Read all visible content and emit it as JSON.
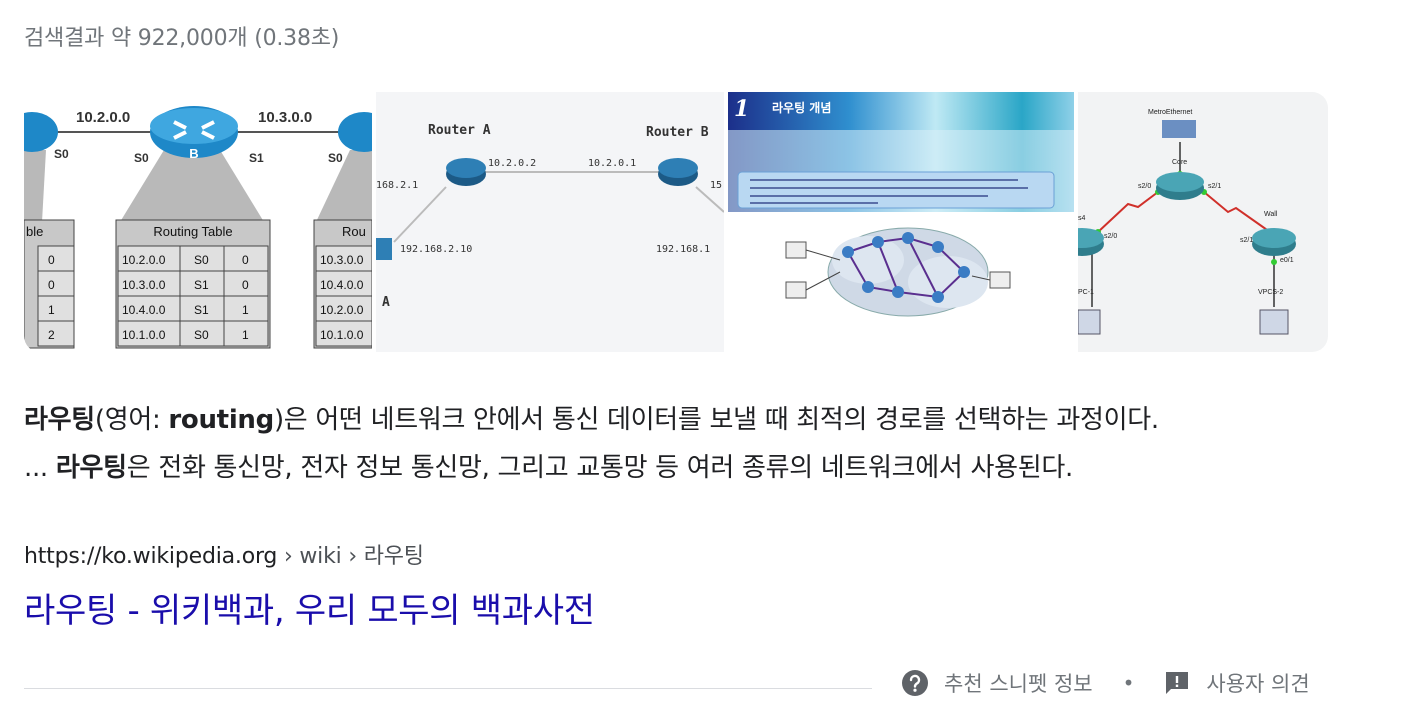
{
  "result_stats": "검색결과 약 922,000개 (0.38초)",
  "images": [
    {
      "alt": "router routing tables",
      "labels": {
        "net_left": "10.2.0.0",
        "net_right": "10.3.0.0",
        "if_s0_a": "S0",
        "if_s0_b": "S0",
        "if_s1": "S1",
        "if_s0_c": "S0",
        "router_b": "B",
        "table_left_head": "ble",
        "table_center_head": "Routing Table",
        "table_right_head": "Rou"
      },
      "left_table": [
        "0",
        "0",
        "1",
        "2"
      ],
      "center_table": [
        [
          "10.2.0.0",
          "S0",
          "0"
        ],
        [
          "10.3.0.0",
          "S1",
          "0"
        ],
        [
          "10.4.0.0",
          "S1",
          "1"
        ],
        [
          "10.1.0.0",
          "S0",
          "1"
        ]
      ],
      "right_table": [
        "10.3.0.0",
        "10.4.0.0",
        "10.2.0.0",
        "10.1.0.0"
      ]
    },
    {
      "alt": "router A and router B diagram",
      "labels": {
        "router_a": "Router A",
        "router_b": "Router B",
        "ip_a_right": "10.2.0.2",
        "ip_b_left": "10.2.0.1",
        "ip_a_left": "168.2.1",
        "ip_b_right": "15",
        "host_a": "192.168.2.10",
        "host_b": "192.168.1",
        "pc_label": "A"
      }
    },
    {
      "alt": "라우팅 개념 slide",
      "labels": {
        "slide_num": "1",
        "slide_title": "라우팅 개념"
      }
    },
    {
      "alt": "network topology with MetroEthernet",
      "labels": {
        "metro": "MetroEthernet",
        "core": "Core",
        "core_left_if": "s2/0",
        "core_right_if": "s2/1",
        "west_if": "s2/0",
        "wall": "Wall",
        "wall_if": "s2/1",
        "wall_down": "e0/1",
        "left_partial": "s4",
        "vpc_left": "PC-1",
        "vpc_right": "VPCS-2"
      }
    }
  ],
  "snippet": {
    "line1_bold1": "라우팅",
    "line1_text1": "(영어: ",
    "line1_bold2": "routing",
    "line1_text2": ")은 어떤 네트워크 안에서 통신 데이터를 보낼 때 최적의 경로를 선택하는 과정이다.",
    "line2_prefix": "... ",
    "line2_bold": "라우팅",
    "line2_text": "은 전화 통신망, 전자 정보 통신망, 그리고 교통망 등 여러 종류의 네트워크에서 사용된다."
  },
  "cite": {
    "domain": "https://ko.wikipedia.org",
    "path": " › wiki › 라우팅"
  },
  "result_title": "라우팅 - 위키백과, 우리 모두의 백과사전",
  "footer": {
    "about_label": "추천 스니펫 정보",
    "separator": "•",
    "feedback_label": "사용자 의견"
  }
}
